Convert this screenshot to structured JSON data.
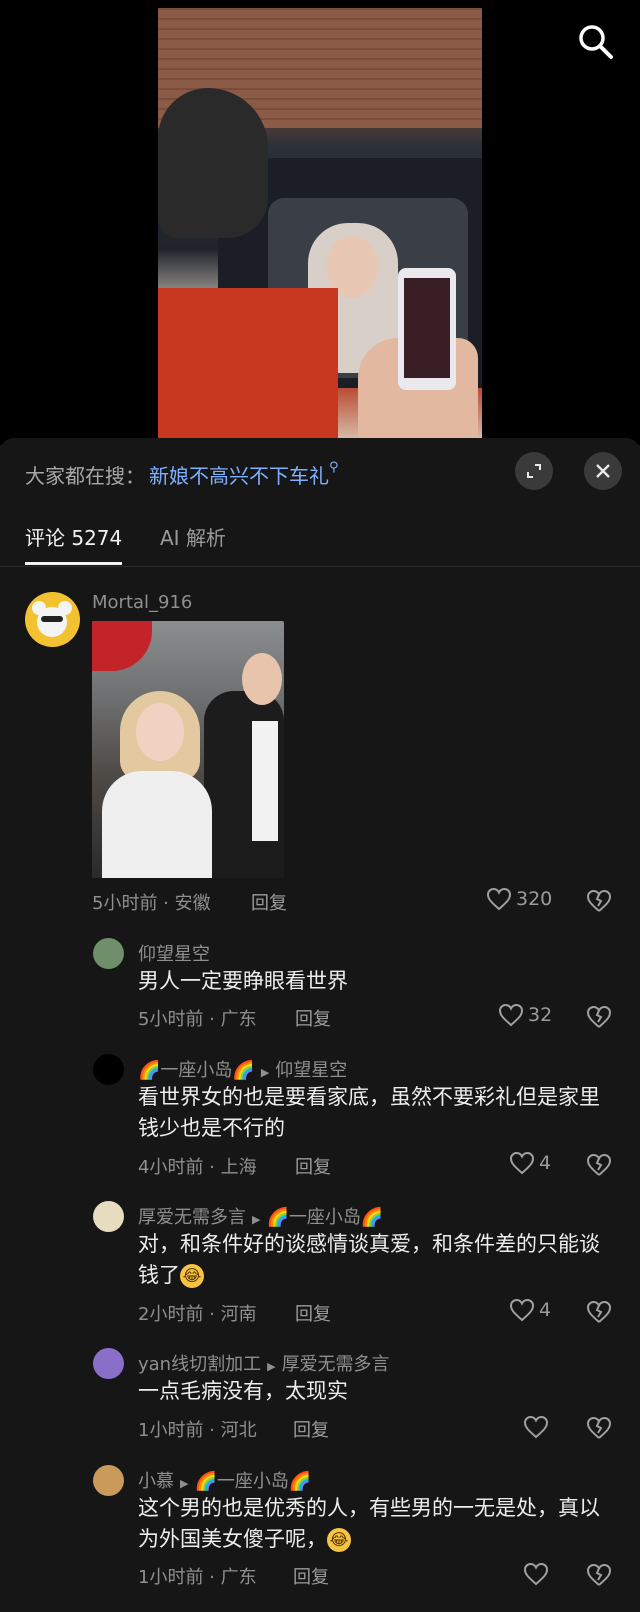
{
  "suggestion": {
    "prefix": "大家都在搜：",
    "keyword": "新娘不高兴不下车礼"
  },
  "tabs": {
    "comments": "评论 5274",
    "ai": "AI 解析"
  },
  "colors": {
    "link": "#7fb0ff",
    "background": "#161616",
    "text": "#ededed",
    "muted": "#8f8f8f"
  },
  "comments": [
    {
      "user": "Mortal_916",
      "meta": "5小时前 · 安徽",
      "reply": "回复",
      "likes": "320"
    },
    {
      "user": "仰望星空",
      "text": "男人一定要睁眼看世界",
      "meta": "5小时前 · 广东",
      "reply": "回复",
      "likes": "32"
    },
    {
      "user": "🌈一座小岛🌈",
      "reply_to": "仰望星空",
      "text": "看世界女的也是要看家底，虽然不要彩礼但是家里钱少也是不行的",
      "meta": "4小时前 · 上海",
      "reply": "回复",
      "likes": "4"
    },
    {
      "user": "厚爱无需多言",
      "reply_to": "🌈一座小岛🌈",
      "text": "对，和条件好的谈感情谈真爱，和条件差的只能谈钱了",
      "meta": "2小时前 · 河南",
      "reply": "回复",
      "likes": "4"
    },
    {
      "user": "yan线切割加工",
      "reply_to": "厚爱无需多言",
      "text": "一点毛病没有，太现实",
      "meta": "1小时前 · 河北",
      "reply": "回复"
    },
    {
      "user": "小慕",
      "reply_to": "🌈一座小岛🌈",
      "text": "这个男的也是优秀的人，有些男的一无是处，真以为外国美女傻子呢，",
      "meta": "1小时前 · 广东",
      "reply": "回复"
    }
  ]
}
